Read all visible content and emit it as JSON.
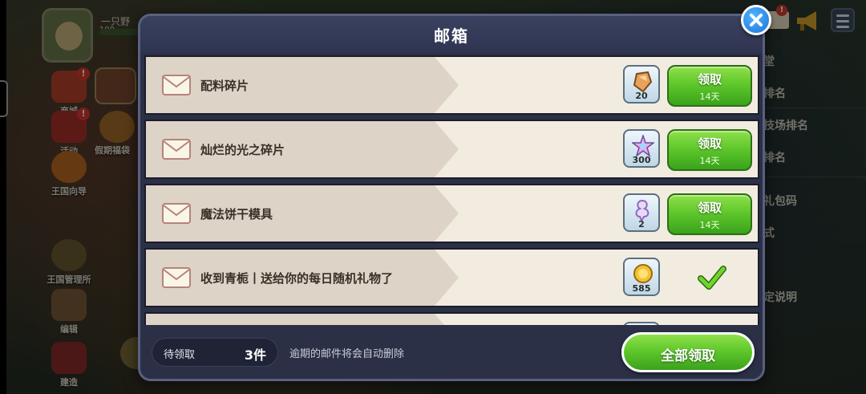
{
  "background": {
    "player_name": "一只野",
    "player_level": "100",
    "left_menu": [
      {
        "label": "商城",
        "badge": "!"
      },
      {
        "label": "活动",
        "badge": "!"
      },
      {
        "label": "王国向导",
        "badge": ""
      },
      {
        "label": "王国管理所",
        "badge": ""
      },
      {
        "label": "编辑",
        "badge": ""
      },
      {
        "label": "建造",
        "badge": ""
      }
    ],
    "holiday_bag_label": "假期福袋",
    "right_menu": [
      "堂",
      "排名",
      "技场排名",
      "排名",
      "礼包码",
      "式",
      "定说明"
    ],
    "mail_badge": "!"
  },
  "mailbox": {
    "title": "邮箱",
    "mails": [
      {
        "title": "配料碎片",
        "item_icon": "ingredient-shard-icon",
        "item_count": "20",
        "claimed": false,
        "claim_label": "领取",
        "days": "14天"
      },
      {
        "title": "灿烂的光之碎片",
        "item_icon": "star-shard-icon",
        "item_count": "300",
        "claimed": false,
        "claim_label": "领取",
        "days": "14天"
      },
      {
        "title": "魔法饼干模具",
        "item_icon": "cookie-mold-icon",
        "item_count": "2",
        "claimed": false,
        "claim_label": "领取",
        "days": "14天"
      },
      {
        "title": "收到青栀丨送给你的每日随机礼物了",
        "item_icon": "gold-coin-icon",
        "item_count": "585",
        "claimed": true,
        "claim_label": "",
        "days": ""
      }
    ],
    "footer": {
      "pending_label": "待领取",
      "pending_count": "3件",
      "note": "逾期的邮件将会自动删除",
      "claim_all_label": "全部领取"
    }
  },
  "colors": {
    "modal_bg": "#2b3046",
    "row_bg": "#f2ebe0",
    "claim_green": "#5cc52a",
    "close_blue": "#1e74d8"
  }
}
